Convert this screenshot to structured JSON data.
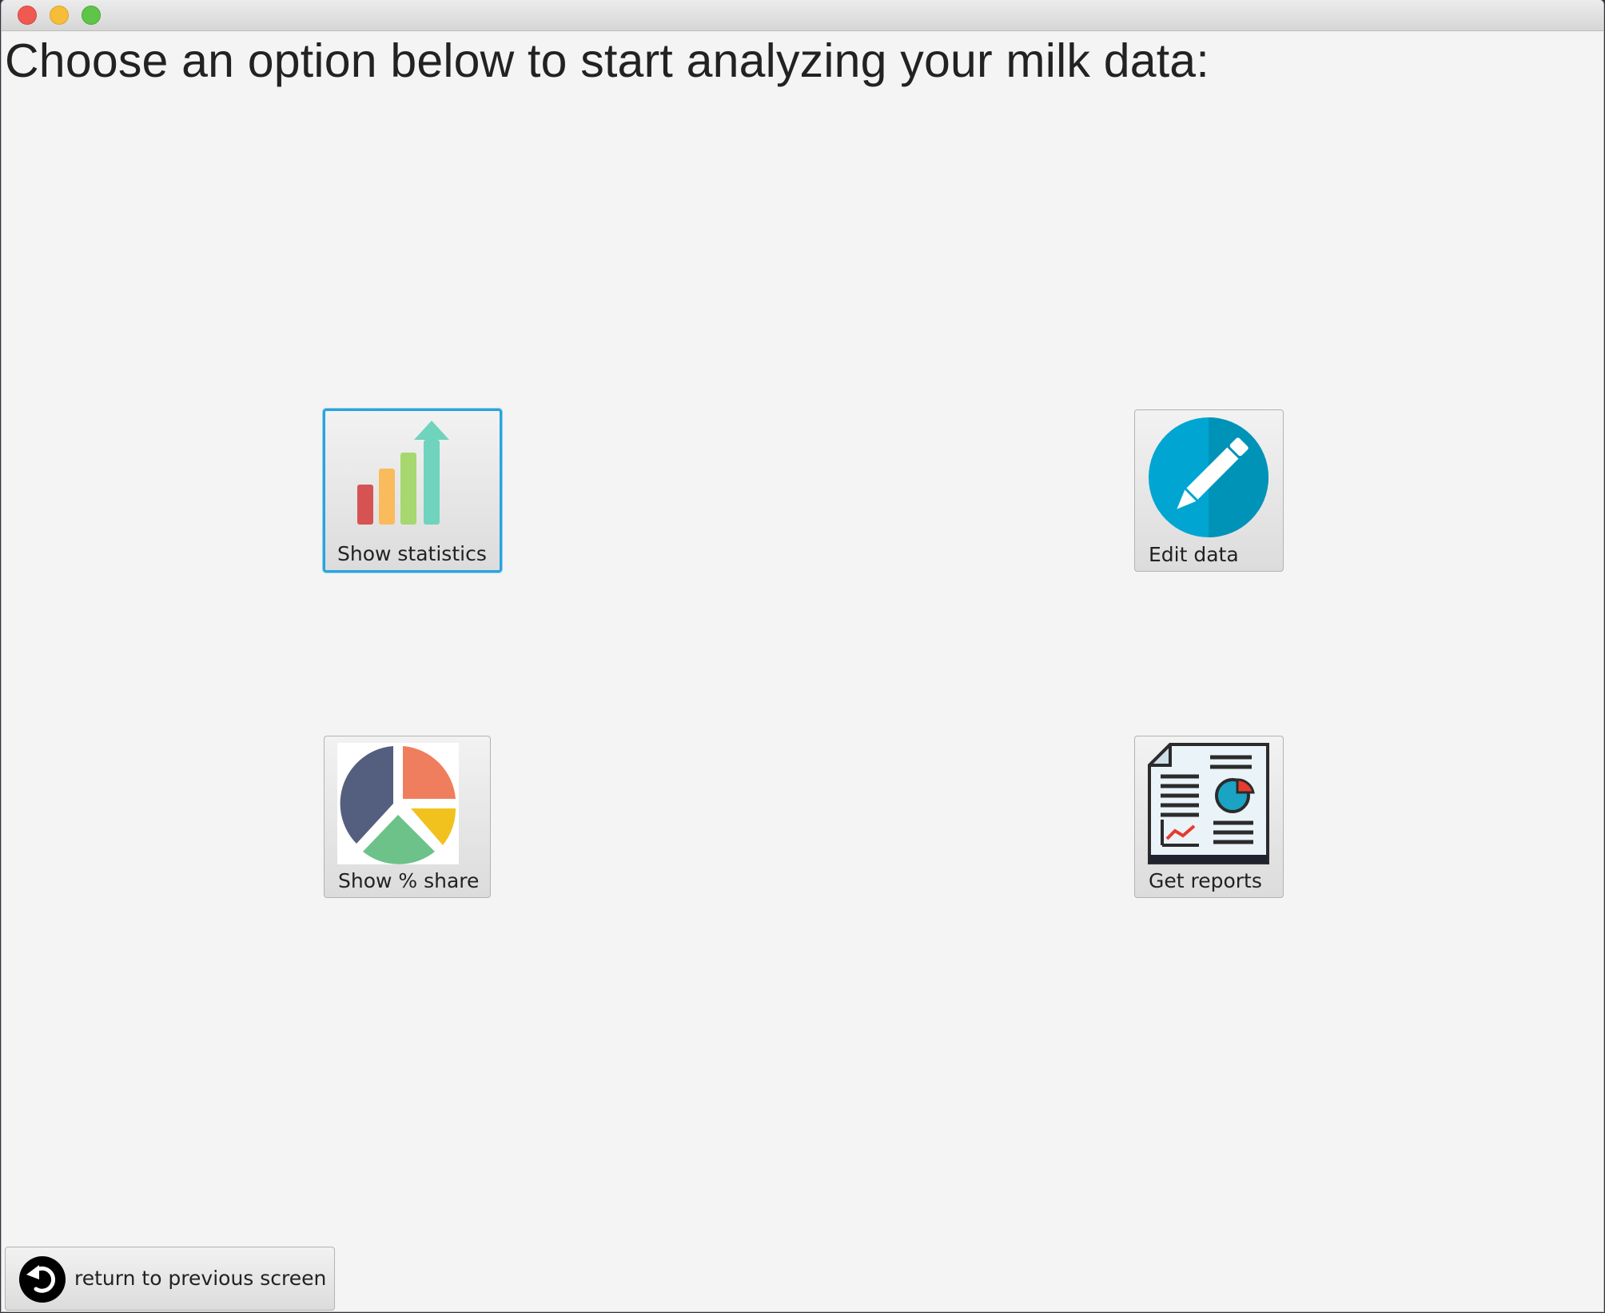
{
  "window": {
    "controls": [
      "close",
      "minimize",
      "zoom"
    ]
  },
  "heading": "Choose an option below to start analyzing your milk data:",
  "options": {
    "show_statistics": {
      "label": "Show statistics",
      "icon": "bar-chart-arrow-icon"
    },
    "edit_data": {
      "label": "Edit data",
      "icon": "pencil-icon"
    },
    "show_share": {
      "label": "Show % share",
      "icon": "pie-chart-icon"
    },
    "get_reports": {
      "label": "Get reports",
      "icon": "report-document-icon"
    }
  },
  "back": {
    "label": "return to previous screen",
    "icon": "return-arrow-icon"
  },
  "colors": {
    "focus_ring": "#2aa3dc",
    "background": "#f4f4f4",
    "bar_red": "#d65353",
    "bar_orange": "#f9bb5c",
    "bar_green": "#a6d86f",
    "arrow_teal": "#6fd3bd",
    "pencil_blue": "#00a6d1",
    "pie_navy": "#545e7e",
    "pie_orange": "#ef7e5e",
    "pie_yellow": "#f1c21e",
    "pie_green": "#6cc288"
  }
}
